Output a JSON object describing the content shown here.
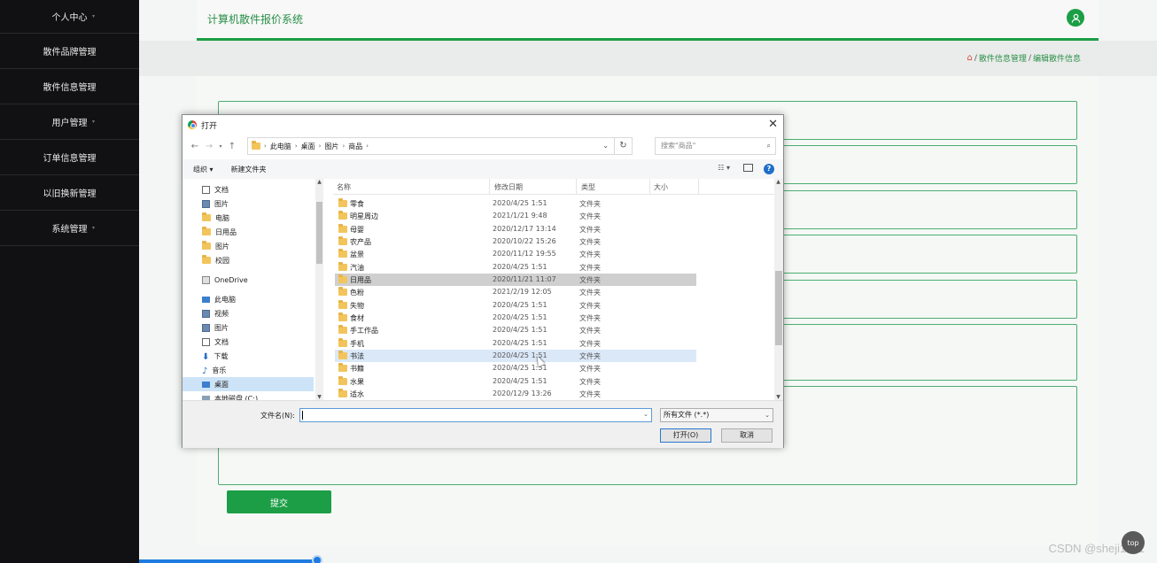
{
  "sidebar": {
    "items": [
      {
        "label": "个人中心"
      },
      {
        "label": "散件品牌管理"
      },
      {
        "label": "散件信息管理"
      },
      {
        "label": "用户管理"
      },
      {
        "label": "订单信息管理"
      },
      {
        "label": "以旧换新管理"
      },
      {
        "label": "系统管理"
      }
    ]
  },
  "header": {
    "title": "计算机散件报价系统",
    "user_icon": "user-icon"
  },
  "breadcrumb": {
    "level1": "散件信息管理",
    "level2": "编辑散件信息",
    "separator": "/"
  },
  "form": {
    "submit_label": "提交"
  },
  "dialog": {
    "title": "打开",
    "path": [
      "此电脑",
      "桌面",
      "图片",
      "商品"
    ],
    "search_placeholder": "搜索\"商品\"",
    "toolbar": {
      "organize": "组织 ▾",
      "new_folder": "新建文件夹"
    },
    "tree": [
      {
        "label": "文档",
        "icon": "doc",
        "pinned": true
      },
      {
        "label": "图片",
        "icon": "pic",
        "pinned": true
      },
      {
        "label": "电脑",
        "icon": "folder"
      },
      {
        "label": "日用品",
        "icon": "folder"
      },
      {
        "label": "图片",
        "icon": "folder"
      },
      {
        "label": "校园",
        "icon": "folder"
      },
      {
        "label": "OneDrive",
        "icon": "cloud"
      },
      {
        "label": "此电脑",
        "icon": "pc"
      },
      {
        "label": "视频",
        "icon": "pic"
      },
      {
        "label": "图片",
        "icon": "pic"
      },
      {
        "label": "文档",
        "icon": "doc"
      },
      {
        "label": "下载",
        "icon": "dl"
      },
      {
        "label": "音乐",
        "icon": "music"
      },
      {
        "label": "桌面",
        "icon": "pc",
        "selected": true
      },
      {
        "label": "本地磁盘 (C:)",
        "icon": "disk"
      }
    ],
    "columns": {
      "name": "名称",
      "date": "修改日期",
      "type": "类型",
      "size": "大小"
    },
    "files": [
      {
        "name": "零食",
        "date": "2020/4/25 1:51",
        "type": "文件夹"
      },
      {
        "name": "明星周边",
        "date": "2021/1/21 9:48",
        "type": "文件夹"
      },
      {
        "name": "母婴",
        "date": "2020/12/17 13:14",
        "type": "文件夹"
      },
      {
        "name": "农产品",
        "date": "2020/10/22 15:26",
        "type": "文件夹"
      },
      {
        "name": "盆景",
        "date": "2020/11/12 19:55",
        "type": "文件夹"
      },
      {
        "name": "汽油",
        "date": "2020/4/25 1:51",
        "type": "文件夹"
      },
      {
        "name": "日用品",
        "date": "2020/11/21 11:07",
        "type": "文件夹",
        "state": "selected"
      },
      {
        "name": "色粉",
        "date": "2021/2/19 12:05",
        "type": "文件夹"
      },
      {
        "name": "失物",
        "date": "2020/4/25 1:51",
        "type": "文件夹"
      },
      {
        "name": "食材",
        "date": "2020/4/25 1:51",
        "type": "文件夹"
      },
      {
        "name": "手工作品",
        "date": "2020/4/25 1:51",
        "type": "文件夹"
      },
      {
        "name": "手机",
        "date": "2020/4/25 1:51",
        "type": "文件夹"
      },
      {
        "name": "书法",
        "date": "2020/4/25 1:51",
        "type": "文件夹",
        "state": "hover"
      },
      {
        "name": "书籍",
        "date": "2020/4/25 1:51",
        "type": "文件夹"
      },
      {
        "name": "水果",
        "date": "2020/4/25 1:51",
        "type": "文件夹"
      },
      {
        "name": "适水",
        "date": "2020/12/9 13:26",
        "type": "文件夹"
      }
    ],
    "filename_label": "文件名(N):",
    "filename_value": "",
    "filter": "所有文件 (*.*)",
    "open_label": "打开(O)",
    "cancel_label": "取消"
  },
  "watermark": "CSDN @sheji1011",
  "top_button": "top"
}
